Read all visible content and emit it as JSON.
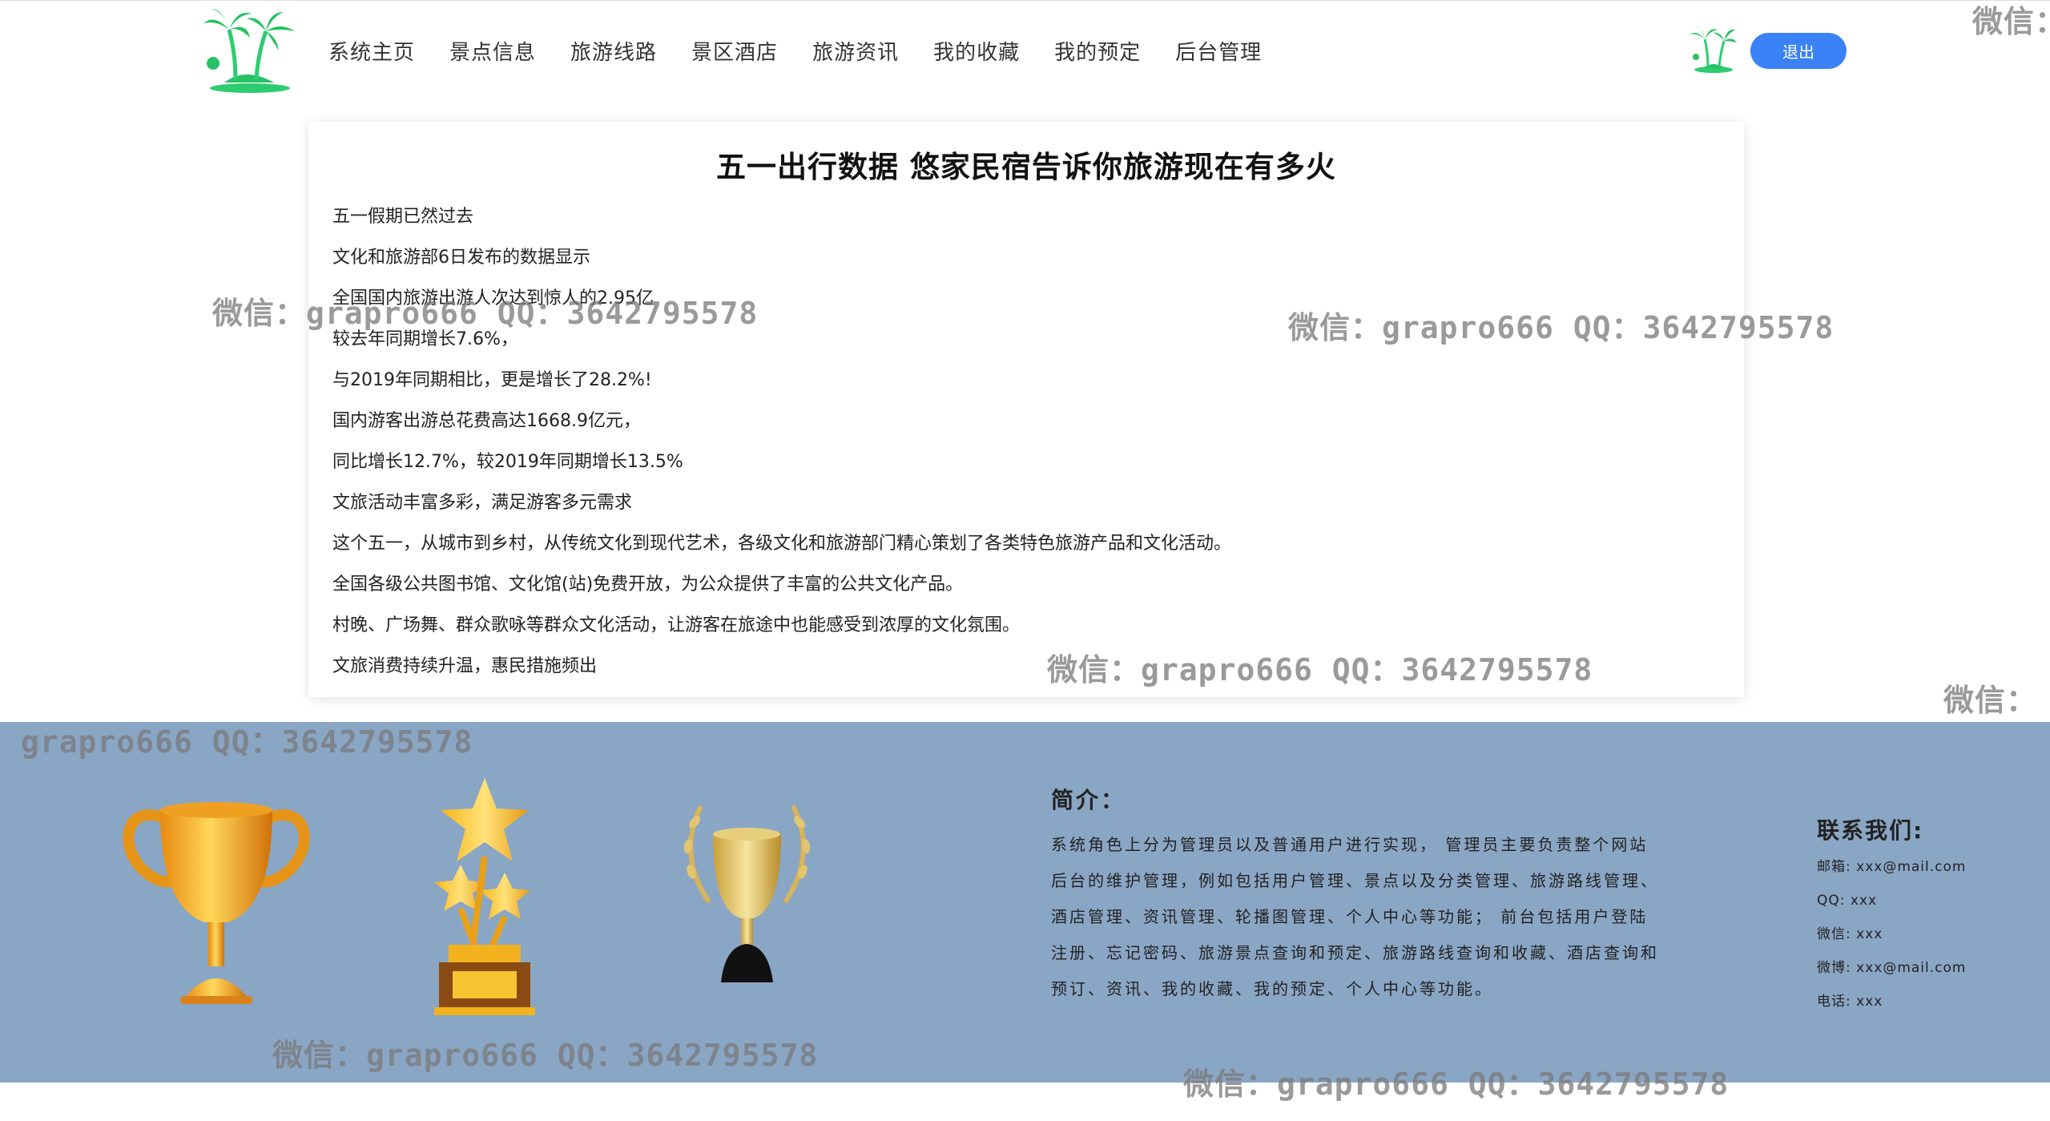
{
  "header": {
    "logo_icon": "palm-tree-island-logo",
    "nav": [
      "系统主页",
      "景点信息",
      "旅游线路",
      "景区酒店",
      "旅游资讯",
      "我的收藏",
      "我的预定",
      "后台管理"
    ],
    "avatar_icon": "palm-tree-avatar",
    "logout_label": "退出"
  },
  "article": {
    "title": "五一出行数据 悠家民宿告诉你旅游现在有多火",
    "paragraphs": [
      "五一假期已然过去",
      "文化和旅游部6日发布的数据显示",
      "全国国内旅游出游人次达到惊人的2.95亿",
      "较去年同期增长7.6%，",
      "与2019年同期相比，更是增长了28.2%!",
      "国内游客出游总花费高达1668.9亿元，",
      "同比增长12.7%，较2019年同期增长13.5%",
      "文旅活动丰富多彩，满足游客多元需求",
      "这个五一，从城市到乡村，从传统文化到现代艺术，各级文化和旅游部门精心策划了各类特色旅游产品和文化活动。",
      "全国各级公共图书馆、文化馆(站)免费开放，为公众提供了丰富的公共文化产品。",
      "村晚、广场舞、群众歌咏等群众文化活动，让游客在旅途中也能感受到浓厚的文化氛围。",
      "文旅消费持续升温，惠民措施频出"
    ]
  },
  "footer": {
    "trophy_icons": [
      "gold-cup-trophy",
      "star-trophy",
      "laurel-trophy"
    ],
    "intro_title": "简介：",
    "intro_text": "系统角色上分为管理员以及普通用户进行实现， 管理员主要负责整个网站后台的维护管理，例如包括用户管理、景点以及分类管理、旅游路线管理、酒店管理、资讯管理、轮播图管理、个人中心等功能； 前台包括用户登陆注册、忘记密码、旅游景点查询和预定、旅游路线查询和收藏、酒店查询和预订、资讯、我的收藏、我的预定、个人中心等功能。",
    "contact_title": "联系我们:",
    "contacts": [
      "邮箱: xxx@mail.com",
      "QQ: xxx",
      "微信: xxx",
      "微博: xxx@mail.com",
      "电话: xxx"
    ]
  },
  "watermarks": {
    "full": "微信：grapro666 QQ：3642795578",
    "partial_a": "grapro666 QQ：3642795578",
    "partial_b": "微信："
  }
}
